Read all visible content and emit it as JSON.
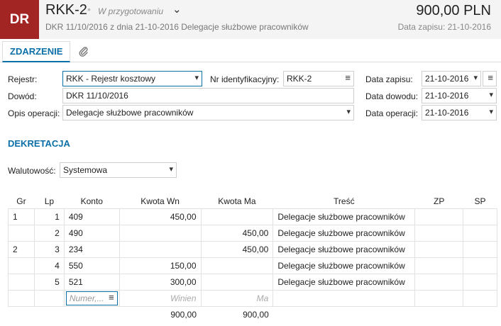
{
  "header": {
    "badge": "DR",
    "title": "RKK-2",
    "status": "W przygotowaniu",
    "subtitle": "DKR 11/10/2016 z dnia 21-10-2016   Delegacje służbowe pracowników",
    "amount": "900,00 PLN",
    "saved": "Data zapisu: 21-10-2016"
  },
  "tabs": {
    "event": "ZDARZENIE"
  },
  "form": {
    "rejestr_label": "Rejestr:",
    "rejestr_value": "RKK - Rejestr kosztowy",
    "nr_label": "Nr identyfikacyjny:",
    "nr_value": "RKK-2",
    "data_zapisu_label": "Data zapisu:",
    "data_zapisu_value": "21-10-2016",
    "dowod_label": "Dowód:",
    "dowod_value": "DKR 11/10/2016",
    "data_dowodu_label": "Data dowodu:",
    "data_dowodu_value": "21-10-2016",
    "opis_label": "Opis operacji:",
    "opis_value": "Delegacje służbowe pracowników",
    "data_operacji_label": "Data operacji:",
    "data_operacji_value": "21-10-2016"
  },
  "dekretacja": {
    "title": "DEKRETACJA",
    "walutowosc_label": "Walutowość:",
    "walutowosc_value": "Systemowa",
    "columns": [
      "Gr",
      "Lp",
      "Konto",
      "Kwota Wn",
      "Kwota Ma",
      "Treść",
      "ZP",
      "SP"
    ],
    "rows": [
      {
        "gr": "1",
        "lp": "1",
        "konto": "409",
        "wn": "450,00",
        "ma": "",
        "tresc": "Delegacje służbowe pracowników"
      },
      {
        "gr": "",
        "lp": "2",
        "konto": "490",
        "wn": "",
        "ma": "450,00",
        "tresc": "Delegacje służbowe pracowników"
      },
      {
        "gr": "2",
        "lp": "3",
        "konto": "234",
        "wn": "",
        "ma": "450,00",
        "tresc": "Delegacje służbowe pracowników"
      },
      {
        "gr": "",
        "lp": "4",
        "konto": "550",
        "wn": "150,00",
        "ma": "",
        "tresc": "Delegacje służbowe pracowników"
      },
      {
        "gr": "",
        "lp": "5",
        "konto": "521",
        "wn": "300,00",
        "ma": "",
        "tresc": "Delegacje służbowe pracowników"
      }
    ],
    "new_row": {
      "konto_placeholder": "Numer,...",
      "wn_placeholder": "Winien",
      "ma_placeholder": "Ma"
    },
    "totals": {
      "wn": "900,00",
      "ma": "900,00"
    }
  }
}
